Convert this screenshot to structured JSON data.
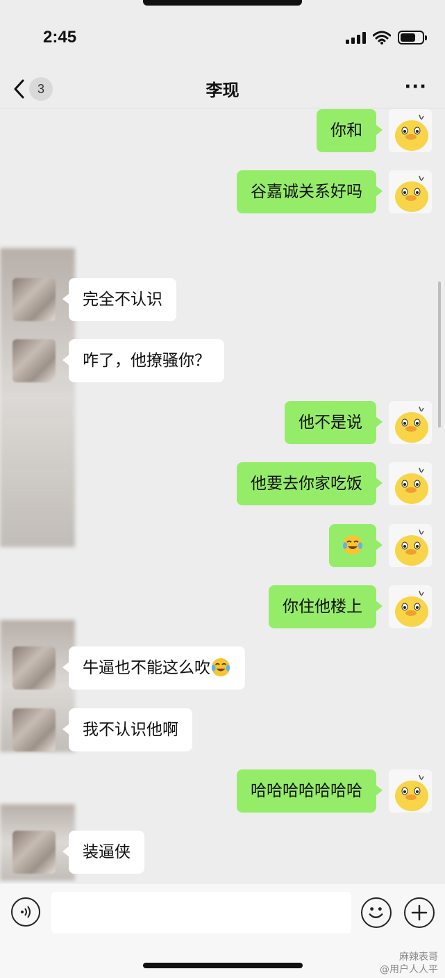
{
  "status_bar": {
    "time": "2:45"
  },
  "nav": {
    "back_count": "3",
    "title": "李现",
    "more": "···"
  },
  "messages": [
    {
      "side": "me",
      "text": "你和"
    },
    {
      "side": "me",
      "text": "谷嘉诚关系好吗"
    },
    {
      "side": "them",
      "text": "完全不认识"
    },
    {
      "side": "them",
      "text": "咋了，他撩骚你？"
    },
    {
      "side": "me",
      "text": "他不是说"
    },
    {
      "side": "me",
      "text": "他要去你家吃饭"
    },
    {
      "side": "me",
      "text": "",
      "emoji": "crying-laughing-emoji"
    },
    {
      "side": "me",
      "text": "你住他楼上"
    },
    {
      "side": "them",
      "text": "牛逼也不能这么吹",
      "emoji": "crying-laughing-emoji"
    },
    {
      "side": "them",
      "text": "我不认识他啊"
    },
    {
      "side": "me",
      "text": "哈哈哈哈哈哈哈"
    },
    {
      "side": "them",
      "text": "装逼侠"
    }
  ],
  "input_bar": {
    "voice_icon": "voice-icon",
    "emoji_icon": "emoji-face-icon",
    "plus_icon": "plus-icon"
  },
  "watermark": {
    "line1": "麻辣表哥",
    "line2": "@用户人人平"
  },
  "colors": {
    "bubble_me": "#95ec69",
    "bubble_them": "#ffffff",
    "background": "#ededed"
  }
}
